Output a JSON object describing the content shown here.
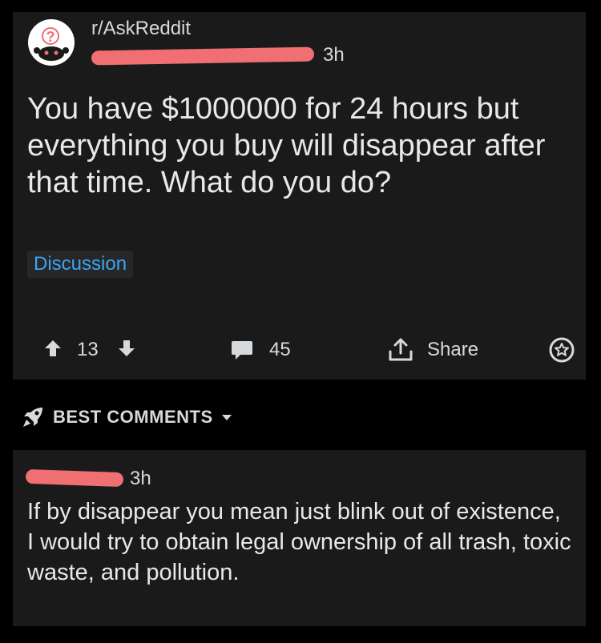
{
  "post": {
    "subreddit": "r/AskReddit",
    "time": "3h",
    "title": "You have $1000000 for 24 hours but everything you buy will disappear after that time. What do you do?",
    "flair": "Discussion",
    "upvotes": "13",
    "comments": "45",
    "share_label": "Share"
  },
  "sort": {
    "label": "BEST COMMENTS"
  },
  "comment": {
    "time": "3h",
    "body": "If by disappear you mean just blink out of existence, I would try to obtain legal ownership of all trash, toxic waste, and pollution."
  },
  "colors": {
    "background": "#000000",
    "card": "#1a1a1b",
    "text": "#d7dadc",
    "flair_text": "#3aa6f0",
    "redaction": "#ef6f73"
  }
}
